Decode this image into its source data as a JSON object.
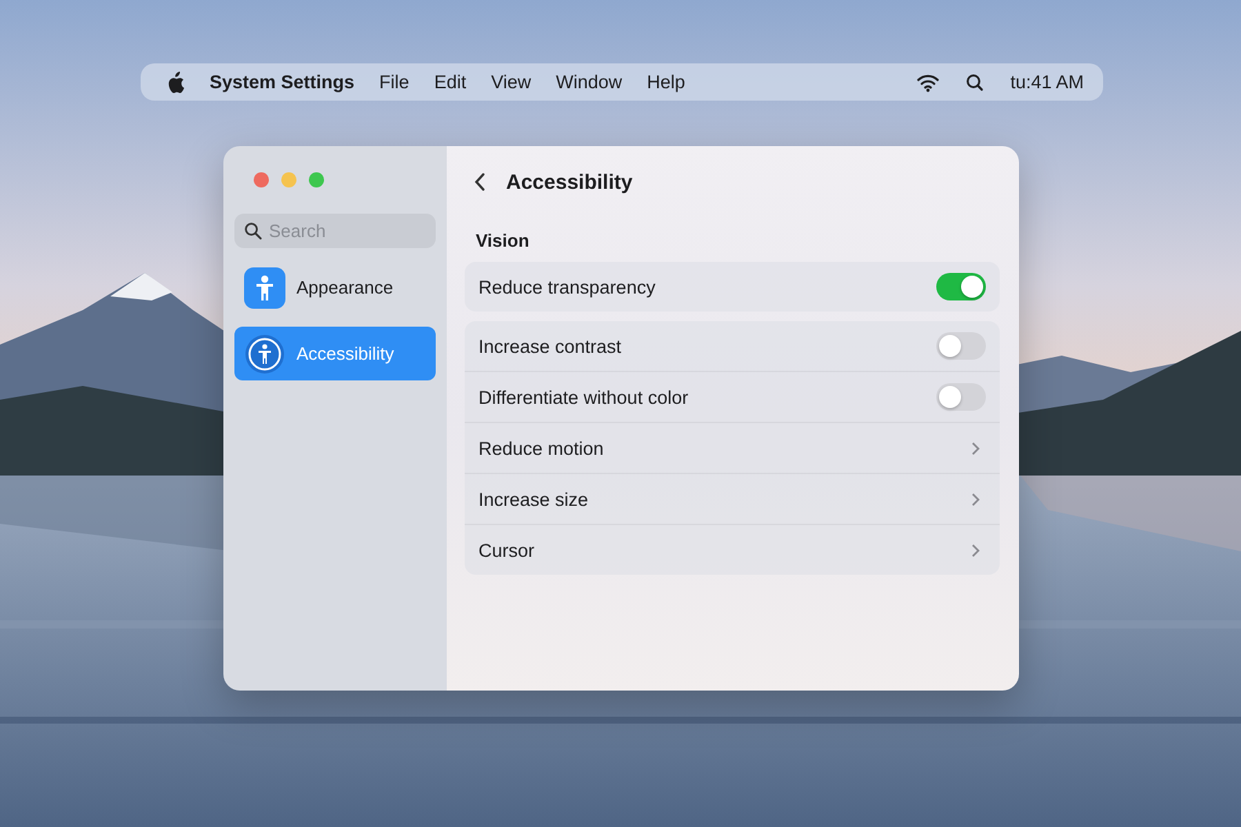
{
  "menu_bar": {
    "app_name": "System Settings",
    "menus": [
      "File",
      "Edit",
      "View",
      "Window",
      "Help"
    ],
    "clock": "tu:41 AM"
  },
  "window": {
    "sidebar": {
      "search": {
        "placeholder": "Search"
      },
      "items": [
        {
          "label": "Appearance",
          "selected": false
        },
        {
          "label": "Accessibility",
          "selected": true
        }
      ]
    },
    "title": "Accessibility",
    "section": "Vision",
    "groups": [
      {
        "rows": [
          {
            "kind": "toggle",
            "label": "Reduce transparency",
            "on": true
          }
        ]
      },
      {
        "rows": [
          {
            "kind": "toggle",
            "label": "Increase contrast",
            "on": false
          },
          {
            "kind": "toggle",
            "label": "Differentiate without color",
            "on": false
          },
          {
            "kind": "link",
            "label": "Reduce motion"
          },
          {
            "kind": "link",
            "label": "Increase size"
          },
          {
            "kind": "link",
            "label": "Cursor"
          }
        ]
      }
    ]
  }
}
